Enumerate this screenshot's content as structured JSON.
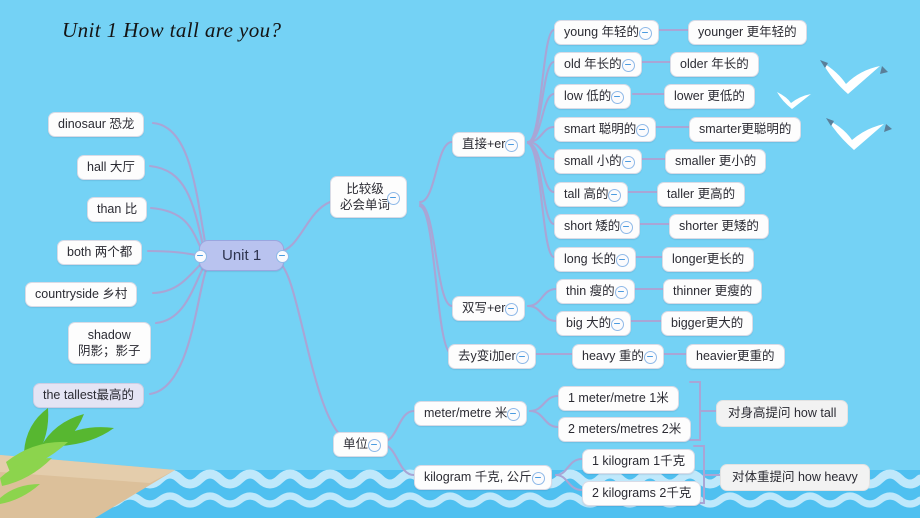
{
  "page": {
    "title": "Unit 1  How tall are you?",
    "background_color": "#74d2f5",
    "link_color": "#a9a5d5",
    "center_node_color": "#b9c3ef"
  },
  "center": {
    "label": "Unit 1"
  },
  "vocabulary": [
    {
      "label": "dinosaur 恐龙"
    },
    {
      "label": "hall 大厅"
    },
    {
      "label": "than 比"
    },
    {
      "label": "both 两个都"
    },
    {
      "label": "countryside 乡村"
    },
    {
      "label_line1": "shadow",
      "label_line2": "阴影；影子"
    },
    {
      "label": "the tallest最高的"
    }
  ],
  "comparative": {
    "label_line1": "比较级",
    "label_line2": "必会单词",
    "groups": [
      {
        "label": "直接+er",
        "pairs": [
          {
            "base": "young 年轻的",
            "comp": "younger 更年轻的"
          },
          {
            "base": "old 年长的",
            "comp": "older 年长的"
          },
          {
            "base": "low 低的",
            "comp": "lower 更低的"
          },
          {
            "base": "smart 聪明的",
            "comp": "smarter更聪明的"
          },
          {
            "base": "small 小的",
            "comp": "smaller 更小的"
          },
          {
            "base": "tall 高的",
            "comp": "taller 更高的"
          },
          {
            "base": "short 矮的",
            "comp": "shorter 更矮的"
          },
          {
            "base": "long 长的",
            "comp": "longer更长的"
          }
        ]
      },
      {
        "label": "双写+er",
        "pairs": [
          {
            "base": "thin 瘦的",
            "comp": "thinner 更瘦的"
          },
          {
            "base": "big 大的",
            "comp": "bigger更大的"
          }
        ]
      },
      {
        "label": "去y变i加er",
        "pairs": [
          {
            "base": "heavy 重的",
            "comp": "heavier更重的"
          }
        ]
      }
    ]
  },
  "units": {
    "label": "单位",
    "groups": [
      {
        "label": "meter/metre 米",
        "items": [
          "1 meter/metre 1米",
          "2 meters/metres 2米"
        ],
        "note": "对身高提问 how tall"
      },
      {
        "label": "kilogram 千克, 公斤",
        "items": [
          "1 kilogram 1千克",
          "2  kilograms 2千克"
        ],
        "note": "对体重提问 how heavy"
      }
    ]
  },
  "decor": {
    "sand_color": "#dcc09a",
    "water_color": "#4fc0f0",
    "wave_color": "#bfe8fb",
    "leaf_colors": [
      "#6cc63f",
      "#8fd44a"
    ],
    "gull_color": "#ffffff"
  }
}
